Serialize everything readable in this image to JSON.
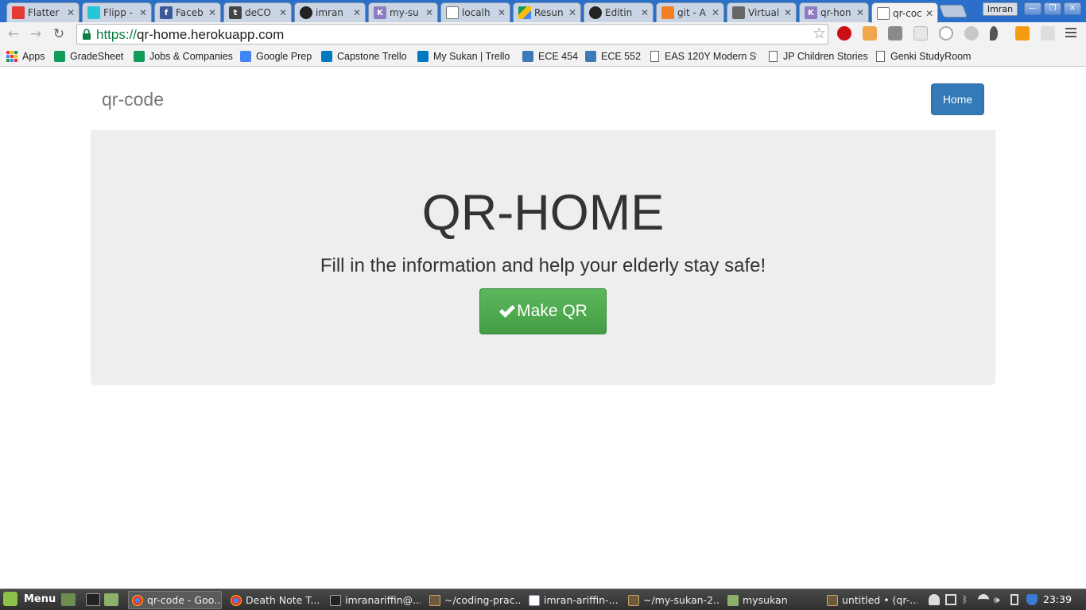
{
  "browser": {
    "tabs": [
      {
        "title": "Flatter",
        "color": "#e53935"
      },
      {
        "title": "Flipp -",
        "color": "#26c6da"
      },
      {
        "title": "Faceb",
        "color": "#3b5998"
      },
      {
        "title": "deCO",
        "color": "#444444"
      },
      {
        "title": "imran",
        "color": "#222222"
      },
      {
        "title": "my-su",
        "color": "#8e7cc3"
      },
      {
        "title": "localh",
        "color": "#ffffff"
      },
      {
        "title": "Resun",
        "color": "#fbbc04"
      },
      {
        "title": "Editin",
        "color": "#222222"
      },
      {
        "title": "git - A",
        "color": "#f48024"
      },
      {
        "title": "Virtual",
        "color": "#666666"
      },
      {
        "title": "qr-hon",
        "color": "#8e7cc3"
      },
      {
        "title": "qr-coc",
        "color": "#ffffff"
      }
    ],
    "profile_name": "Imran",
    "url_scheme": "https://",
    "url_host": "qr-home.herokuapp.com",
    "bookmarks": [
      {
        "label": "Apps",
        "icon": "apps-grid-icon"
      },
      {
        "label": "GradeSheet",
        "icon": "sheets-icon"
      },
      {
        "label": "Jobs & Companies",
        "icon": "sheets-icon"
      },
      {
        "label": "Google Prep",
        "icon": "docs-icon"
      },
      {
        "label": "Capstone Trello",
        "icon": "trello-icon"
      },
      {
        "label": "My Sukan | Trello",
        "icon": "trello-icon"
      },
      {
        "label": "ECE 454",
        "icon": "piazza-icon"
      },
      {
        "label": "ECE 552",
        "icon": "piazza-icon"
      },
      {
        "label": "EAS 120Y Modern St",
        "icon": "page-icon"
      },
      {
        "label": "JP Children Stories",
        "icon": "page-icon"
      },
      {
        "label": "Genki StudyRoom",
        "icon": "page-icon"
      }
    ]
  },
  "page": {
    "brand": "qr-code",
    "nav_home": "Home",
    "heading": "QR-HOME",
    "lead": "Fill in the information and help your elderly stay safe!",
    "cta_label": "Make QR",
    "accent_color": "#337ab7",
    "cta_color": "#5cb85c"
  },
  "taskbar": {
    "menu_label": "Menu",
    "tasks": [
      {
        "label": "qr-code - Goo...",
        "active": true
      },
      {
        "label": "Death Note T...",
        "active": false
      },
      {
        "label": "imranariffin@...",
        "active": false
      },
      {
        "label": "~/coding-prac...",
        "active": false
      },
      {
        "label": "imran-ariffin-...",
        "active": false
      },
      {
        "label": "~/my-sukan-2...",
        "active": false
      },
      {
        "label": "mysukan",
        "active": false
      },
      {
        "label": "untitled • (qr-...",
        "active": false
      }
    ],
    "clock": "23:39"
  }
}
